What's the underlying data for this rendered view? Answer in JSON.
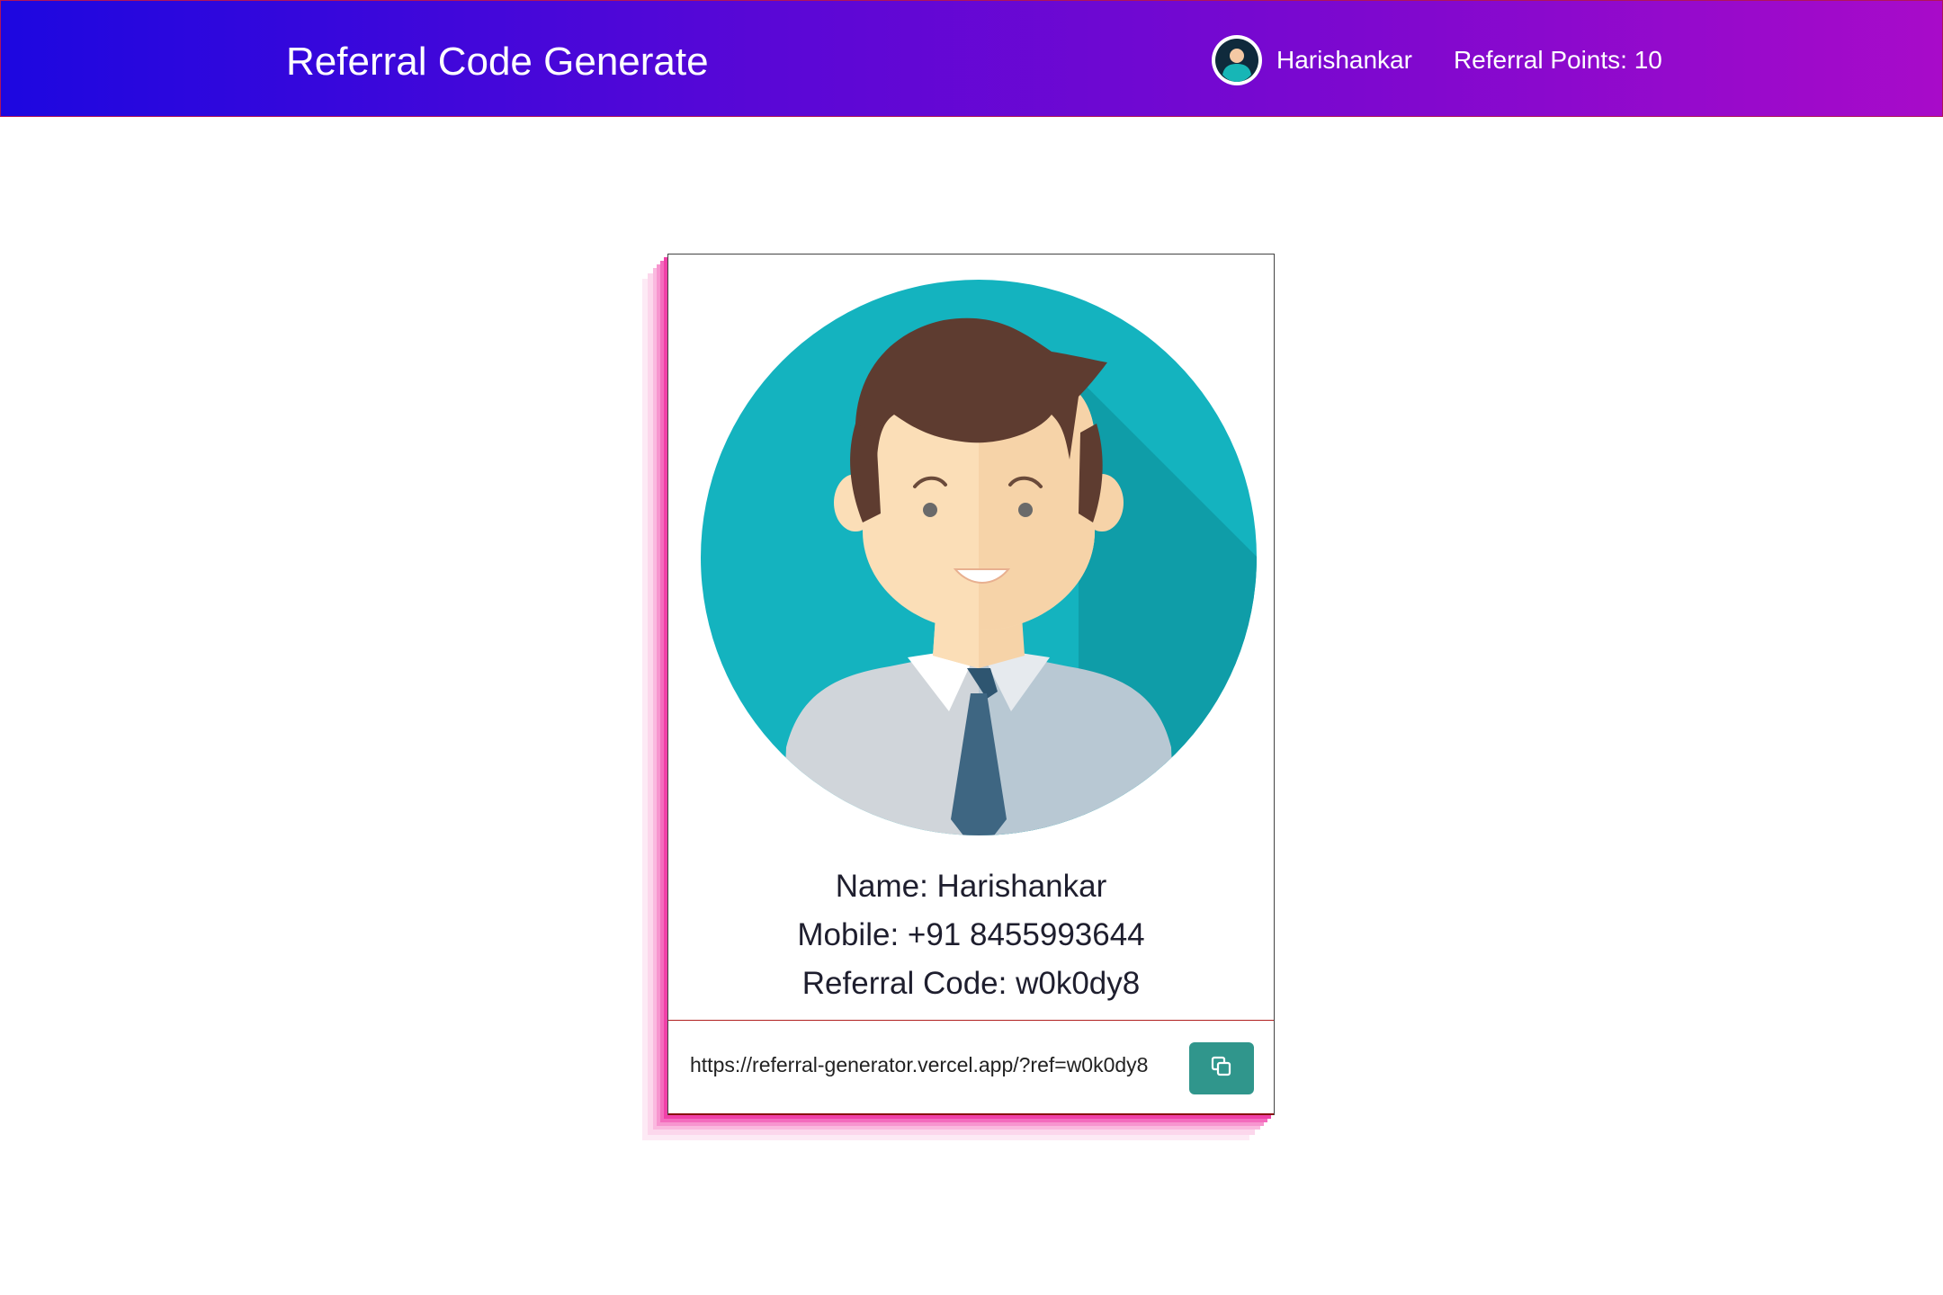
{
  "navbar": {
    "title": "Referral Code Generate",
    "avatar_icon": "user-avatar-icon",
    "username": "Harishankar",
    "referral_points": "Referral Points: 10"
  },
  "profile": {
    "avatar_icon": "man-avatar-illustration",
    "name": "Name: Harishankar",
    "mobile": "Mobile: +91 8455993644",
    "referral_code": "Referral Code: w0k0dy8",
    "referral_link": "https://referral-generator.vercel.app/?ref=w0k0dy8",
    "copy_icon": "copy-icon"
  },
  "colors": {
    "navbar_gradient_start": "#1d07e0",
    "navbar_gradient_end": "#a80bc9",
    "avatar_teal": "#14b3bf",
    "copy_button": "#30968c",
    "card_shadow_pink": "#f040a8"
  }
}
